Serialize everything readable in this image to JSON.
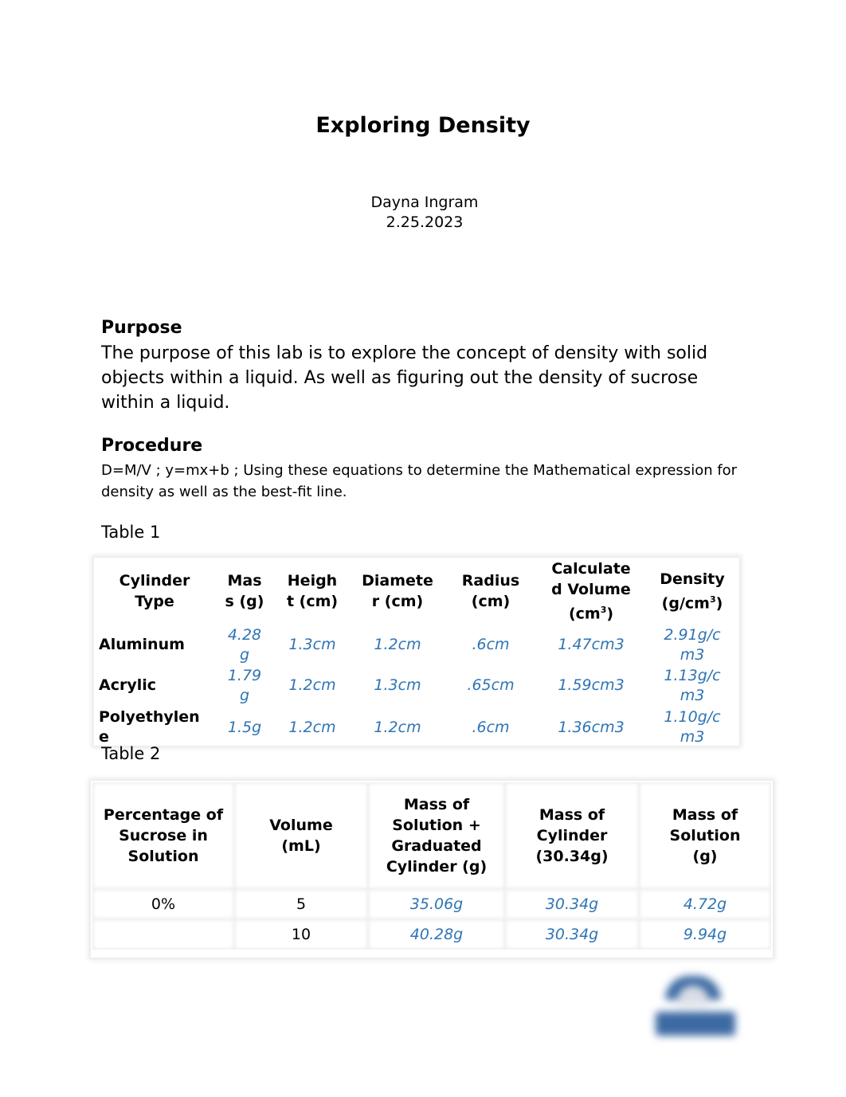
{
  "document": {
    "title": "Exploring Density",
    "author": "Dayna Ingram",
    "date": "2.25.2023"
  },
  "purpose": {
    "heading": "Purpose",
    "text": "The purpose of this lab is to explore the concept of density with solid objects within a liquid. As well as figuring out the density of sucrose within a liquid."
  },
  "procedure": {
    "heading": "Procedure",
    "text": "D=M/V ; y=mx+b ; Using these equations to determine the Mathematical expression for density as well as the best-fit line."
  },
  "table1": {
    "caption": "Table 1",
    "headers": [
      "Cylinder Type",
      "Mass (g)",
      "Height (cm)",
      "Diameter (cm)",
      "Radius (cm)",
      "Calculated Volume (cm³)",
      "Density (g/cm³)"
    ],
    "rows": [
      {
        "type": "Aluminum",
        "mass": "4.28g",
        "height": "1.3cm",
        "diameter": "1.2cm",
        "radius": ".6cm",
        "volume": "1.47cm3",
        "density": "2.91g/cm3"
      },
      {
        "type": "Acrylic",
        "mass": "1.79g",
        "height": "1.2cm",
        "diameter": "1.3cm",
        "radius": ".65cm",
        "volume": "1.59cm3",
        "density": "1.13g/cm3"
      },
      {
        "type": "Polyethylene",
        "mass": "1.5g",
        "height": "1.2cm",
        "diameter": "1.2cm",
        "radius": ".6cm",
        "volume": "1.36cm3",
        "density": "1.10g/cm3"
      }
    ]
  },
  "table2": {
    "caption": "Table 2",
    "headers": [
      "Percentage of Sucrose in Solution",
      "Volume (mL)",
      "Mass of Solution + Graduated Cylinder (g)",
      "Mass of Cylinder (30.34g)",
      "Mass of Solution (g)"
    ],
    "rows": [
      {
        "percent": "0%",
        "volume": "5",
        "mass_total": "35.06g",
        "mass_cylinder": "30.34g",
        "mass_solution": "4.72g"
      },
      {
        "percent": "",
        "volume": "10",
        "mass_total": "40.28g",
        "mass_cylinder": "30.34g",
        "mass_solution": "9.94g"
      }
    ]
  },
  "colors": {
    "value_text": "#2e74b5",
    "logo": "#3d6aa3"
  },
  "logo": {
    "icon": "institution-logo-icon"
  }
}
